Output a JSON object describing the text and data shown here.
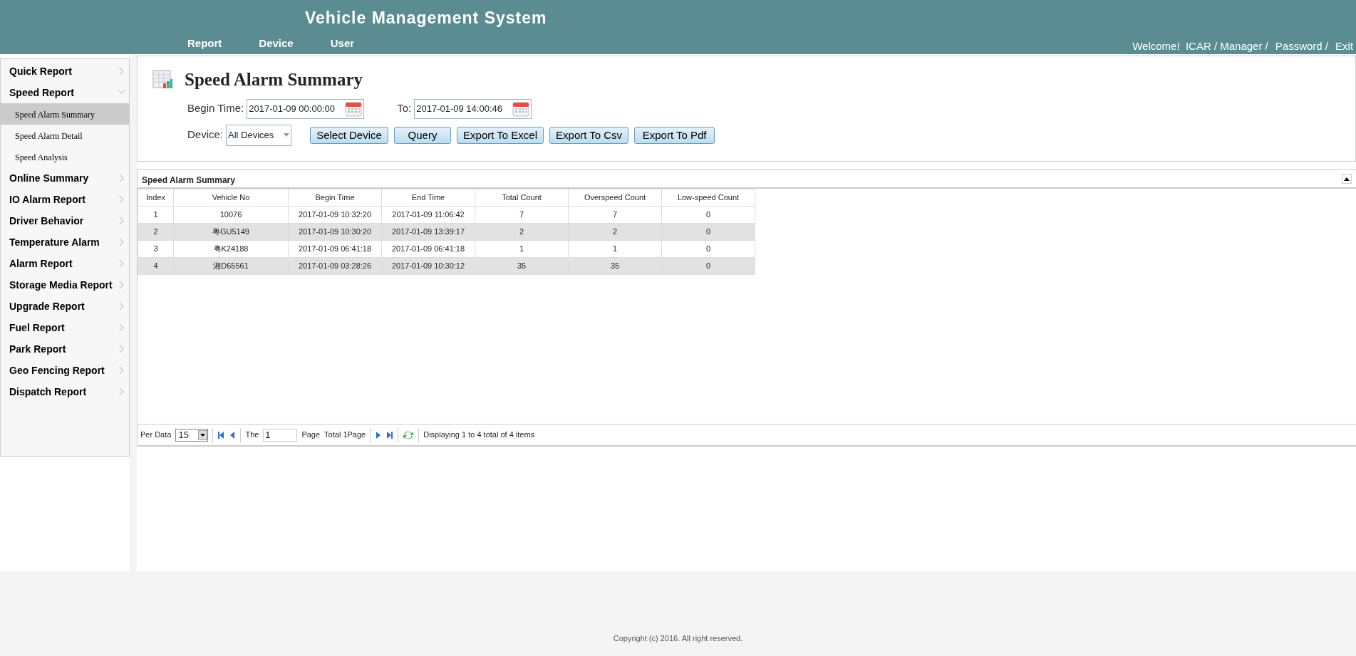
{
  "header": {
    "title": "Vehicle Management System",
    "nav": [
      {
        "label": "Report"
      },
      {
        "label": "Device"
      },
      {
        "label": "User"
      }
    ],
    "user_links": [
      "Welcome!  ICAR / Manager /",
      "Password /",
      "Exit"
    ]
  },
  "sidebar": {
    "items": [
      {
        "label": "Quick Report",
        "expanded": false
      },
      {
        "label": "Speed Report",
        "expanded": true,
        "children": [
          {
            "label": "Speed Alarm Summary",
            "selected": true
          },
          {
            "label": "Speed Alarm Detail",
            "selected": false
          },
          {
            "label": "Speed Analysis",
            "selected": false
          }
        ]
      },
      {
        "label": "Online Summary",
        "expanded": false
      },
      {
        "label": "IO Alarm Report",
        "expanded": false
      },
      {
        "label": "Driver Behavior",
        "expanded": false
      },
      {
        "label": "Temperature Alarm",
        "expanded": false
      },
      {
        "label": "Alarm Report",
        "expanded": false
      },
      {
        "label": "Storage Media Report",
        "expanded": false
      },
      {
        "label": "Upgrade Report",
        "expanded": false
      },
      {
        "label": "Fuel Report",
        "expanded": false
      },
      {
        "label": "Park Report",
        "expanded": false
      },
      {
        "label": "Geo Fencing Report",
        "expanded": false
      },
      {
        "label": "Dispatch Report",
        "expanded": false
      }
    ]
  },
  "form": {
    "title": "Speed Alarm Summary",
    "begin_label": "Begin Time:",
    "begin_value": "2017-01-09 00:00:00",
    "to_label": "To:",
    "to_value": "2017-01-09 14:00:46",
    "device_label": "Device:",
    "device_value": "All Devices",
    "buttons": [
      "Select Device",
      "Query",
      "Export To Excel",
      "Export To Csv",
      "Export To Pdf"
    ]
  },
  "grid": {
    "title": "Speed Alarm Summary",
    "columns": [
      "Index",
      "Vehicle No",
      "Begin Time",
      "End Time",
      "Total Count",
      "Overspeed Count",
      "Low-speed Count"
    ],
    "rows": [
      [
        "1",
        "10076",
        "2017-01-09 10:32:20",
        "2017-01-09 11:06:42",
        "7",
        "7",
        "0"
      ],
      [
        "2",
        "粤GU5149",
        "2017-01-09 10:30:20",
        "2017-01-09 13:39:17",
        "2",
        "2",
        "0"
      ],
      [
        "3",
        "粤K24188",
        "2017-01-09 06:41:18",
        "2017-01-09 06:41:18",
        "1",
        "1",
        "0"
      ],
      [
        "4",
        "湘D65561",
        "2017-01-09 03:28:26",
        "2017-01-09 10:30:12",
        "35",
        "35",
        "0"
      ]
    ]
  },
  "pager": {
    "per_label": "Per Data",
    "per_value": "15",
    "the_label": "The",
    "page_value": "1",
    "page_label": "Page",
    "total": "Total 1Page",
    "display": "Displaying 1 to 4 total of 4 items"
  },
  "footer": "Copyright (c) 2016. All right reserved."
}
